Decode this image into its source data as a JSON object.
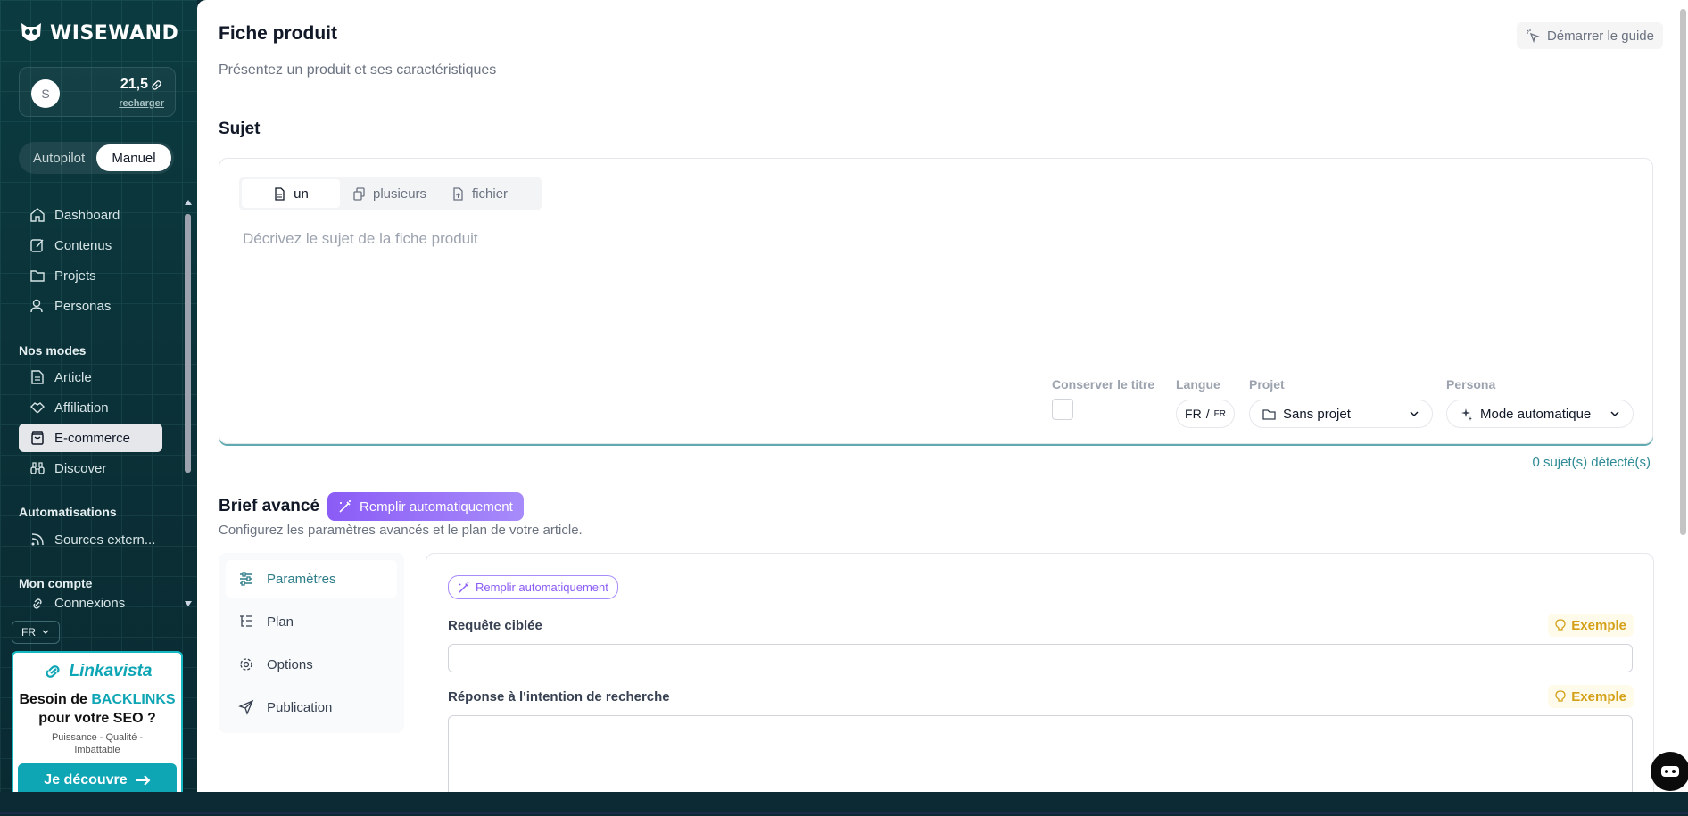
{
  "brand": {
    "name": "WISEWAND"
  },
  "account": {
    "avatar_initial": "S",
    "credits": "21,5",
    "recharge_label": "recharger"
  },
  "mode_toggle": {
    "options": [
      "Autopilot",
      "Manuel"
    ],
    "selected": "Manuel"
  },
  "sidebar": {
    "main_items": [
      {
        "label": "Dashboard",
        "icon": "home-icon"
      },
      {
        "label": "Contenus",
        "icon": "edit-icon"
      },
      {
        "label": "Projets",
        "icon": "folder-icon"
      },
      {
        "label": "Personas",
        "icon": "user-icon"
      }
    ],
    "modes_heading": "Nos modes",
    "mode_items": [
      {
        "label": "Article",
        "icon": "document-icon"
      },
      {
        "label": "Affiliation",
        "icon": "handshake-icon"
      },
      {
        "label": "E-commerce",
        "icon": "shopping-bag-icon",
        "active": true
      },
      {
        "label": "Discover",
        "icon": "binoculars-icon"
      }
    ],
    "automation_heading": "Automatisations",
    "automation_items": [
      {
        "label": "Sources extern...",
        "icon": "rss-icon"
      }
    ],
    "account_heading": "Mon compte",
    "account_items": [
      {
        "label": "Connexions",
        "icon": "link-icon"
      }
    ],
    "language": "FR"
  },
  "promo": {
    "brand": "Linkavista",
    "headline_prefix": "Besoin de ",
    "headline_highlight": "BACKLINKS",
    "headline_suffix": "pour votre SEO ?",
    "subtext": "Puissance - Qualité - Imbattable",
    "cta": "Je découvre"
  },
  "header": {
    "title": "Fiche produit",
    "subtitle": "Présentez un produit et ses caractéristiques",
    "guide_button": "Démarrer le guide"
  },
  "subject": {
    "heading": "Sujet",
    "tabs": [
      {
        "label": "un",
        "icon": "file-icon",
        "active": true
      },
      {
        "label": "plusieurs",
        "icon": "files-icon"
      },
      {
        "label": "fichier",
        "icon": "file-upload-icon"
      }
    ],
    "placeholder": "Décrivez le sujet de la fiche produit",
    "keep_title_label": "Conserver le titre",
    "keep_title_checked": false,
    "language_label": "Langue",
    "language_value_main": "FR",
    "language_value_sub": "FR",
    "project_label": "Projet",
    "project_value": "Sans projet",
    "persona_label": "Persona",
    "persona_value": "Mode automatique",
    "detected": "0 sujet(s) détecté(s)"
  },
  "brief": {
    "heading": "Brief avancé",
    "autofill_label": "Remplir automatiquement",
    "subtitle": "Configurez les paramètres avancés et le plan de votre article.",
    "nav": [
      {
        "label": "Paramètres",
        "icon": "sliders-icon",
        "active": true
      },
      {
        "label": "Plan",
        "icon": "list-tree-icon"
      },
      {
        "label": "Options",
        "icon": "gear-icon"
      },
      {
        "label": "Publication",
        "icon": "send-icon"
      }
    ],
    "form": {
      "autofill_label": "Remplir automatiquement",
      "fields": [
        {
          "label": "Requête ciblée",
          "example": "Exemple",
          "value": ""
        },
        {
          "label": "Réponse à l'intention de recherche",
          "example": "Exemple",
          "value": ""
        }
      ]
    }
  },
  "colors": {
    "accent": "#0ea5b5",
    "sidebar_bg": "#0b3b40",
    "violet": "#8b5cf6",
    "example": "#d4a017"
  }
}
